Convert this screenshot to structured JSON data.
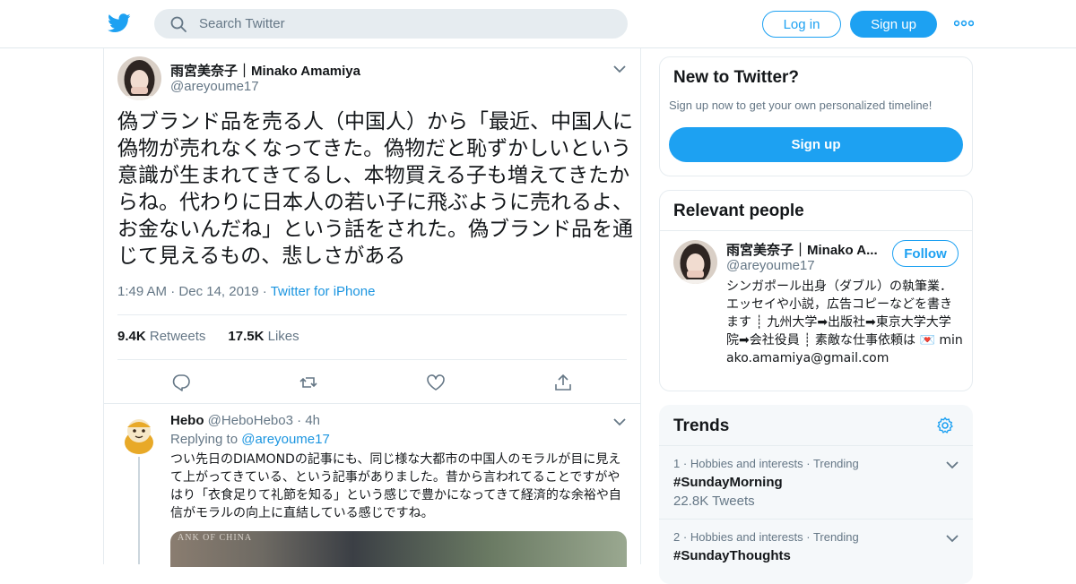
{
  "header": {
    "search_placeholder": "Search Twitter",
    "login_label": "Log in",
    "signup_label": "Sign up",
    "brand_color": "#1da1f2",
    "icons": [
      "twitter-bird-icon",
      "search-icon",
      "more-dots-icon"
    ]
  },
  "tweet": {
    "author_name": "雨宮美奈子｜Minako Amamiya",
    "author_handle": "@areyoume17",
    "text": "偽ブランド品を売る人（中国人）から「最近、中国人に偽物が売れなくなってきた。偽物だと恥ずかしいという意識が生まれてきてるし、本物買える子も増えてきたからね。代わりに日本人の若い子に飛ぶように売れるよ、お金ないんだね」という話をされた。偽ブランド品を通じて見えるもの、悲しさがある",
    "time": "1:49 AM",
    "separator": "·",
    "date": "Dec 14, 2019",
    "source": "Twitter for iPhone",
    "retweets_count": "9.4K",
    "retweets_label": "Retweets",
    "likes_count": "17.5K",
    "likes_label": "Likes",
    "actions": [
      "reply-icon",
      "retweet-icon",
      "like-icon",
      "share-icon"
    ]
  },
  "reply": {
    "author_name": "Hebo",
    "author_handle": "@HeboHebo3",
    "separator": "·",
    "time": "4h",
    "replying_label": "Replying to",
    "replying_to": "@areyoume17",
    "text": "つい先日のDIAMONDの記事にも、同じ様な大都市の中国人のモラルが目に見えて上がってきている、という記事がありました。昔から言われてることですがやはり「衣食足りて礼節を知る」という感じで豊かになってきて経済的な余裕や自信がモラルの向上に直結している感じですね。",
    "media_caption": "ANK OF CHINA"
  },
  "new_to_twitter": {
    "title": "New to Twitter?",
    "subtitle": "Sign up now to get your own personalized timeline!",
    "signup_label": "Sign up"
  },
  "relevant_people": {
    "title": "Relevant people",
    "name": "雨宮美奈子｜Minako A...",
    "handle": "@areyoume17",
    "follow_label": "Follow",
    "bio": "シンガポール出身（ダブル）の執筆業．エッセイや小説，広告コピーなどを書きます ┊ 九州大学➡出版社➡東京大学大学院➡会社役員 ┊ 素敵な仕事依頼は 💌 minako.amamiya@gmail.com"
  },
  "trends": {
    "title": "Trends",
    "items": [
      {
        "rank": "1",
        "dot": "·",
        "category": "Hobbies and interests",
        "dot2": "·",
        "status": "Trending",
        "name": "#SundayMorning",
        "count": "22.8K Tweets"
      },
      {
        "rank": "2",
        "dot": "·",
        "category": "Hobbies and interests",
        "dot2": "·",
        "status": "Trending",
        "name": "#SundayThoughts",
        "count": ""
      }
    ]
  }
}
